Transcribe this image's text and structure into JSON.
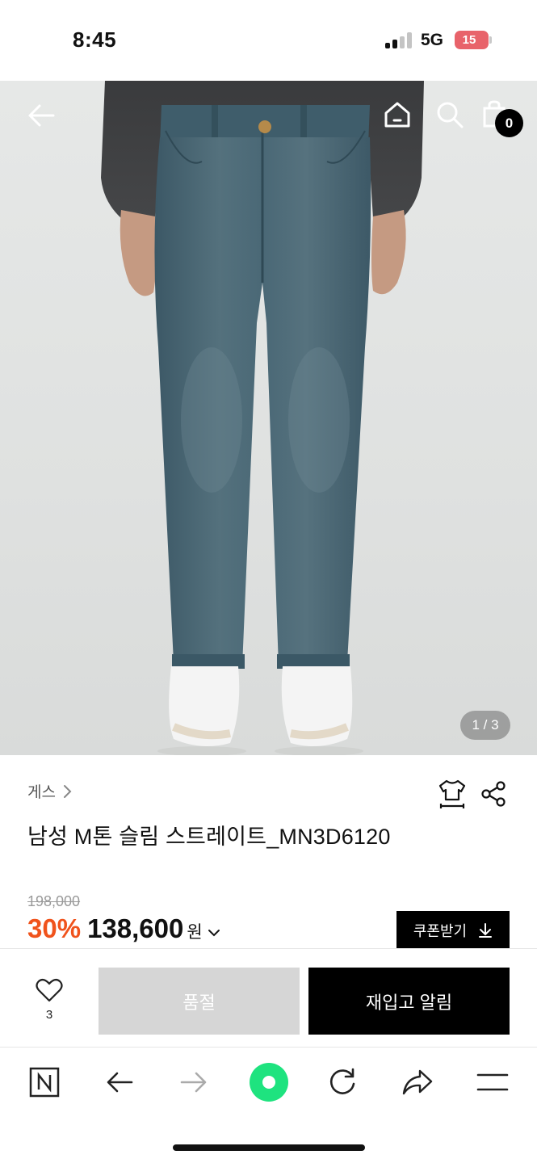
{
  "status_bar": {
    "time": "8:45",
    "network": "5G",
    "battery": "15",
    "battery_color": "#e8636a"
  },
  "hero": {
    "pager": "1 / 3",
    "cart_count": "0",
    "icons": [
      "back-arrow-icon",
      "home-icon",
      "search-icon",
      "shopping-bag-icon"
    ]
  },
  "product": {
    "brand": "게스",
    "title": "남성 M톤 슬림 스트레이트_MN3D6120",
    "original_price": "198,000",
    "discount": "30%",
    "price": "138,600",
    "currency": "원",
    "coupon_label": "쿠폰받기",
    "accent_color": "#f0531c"
  },
  "actions": {
    "like_count": "3",
    "soldout_label": "품절",
    "restock_label": "재입고 알림"
  },
  "browser_bar": {
    "icons": [
      "naver-n-icon",
      "back-icon",
      "forward-icon",
      "green-dot-icon",
      "reload-icon",
      "share-icon",
      "menu-icon"
    ],
    "accent_color": "#1ee37f"
  }
}
